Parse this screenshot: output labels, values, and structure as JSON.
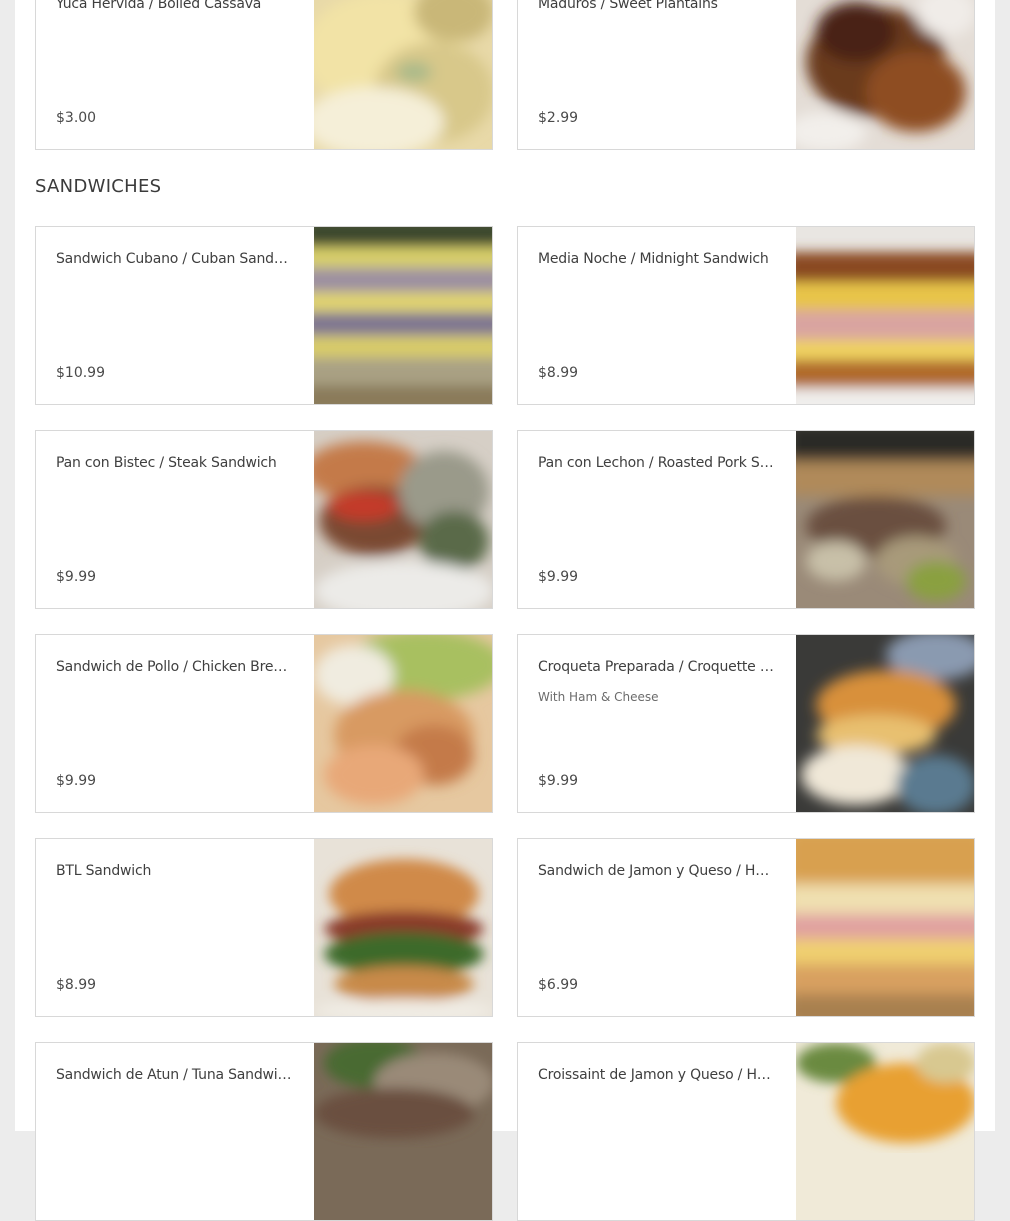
{
  "top_items": [
    {
      "name": "Yuca Hervida / Boiled Cassava",
      "price": "$3.00",
      "image": "boiled-cassava-photo"
    },
    {
      "name": "Maduros / Sweet Plantains",
      "price": "$2.99",
      "image": "sweet-plantains-photo"
    }
  ],
  "section": {
    "title": "SANDWICHES"
  },
  "items": [
    {
      "name": "Sandwich Cubano / Cuban Sandwich",
      "price": "$10.99",
      "image": "cuban-sandwich-photo"
    },
    {
      "name": "Media Noche / Midnight Sandwich",
      "price": "$8.99",
      "image": "midnight-sandwich-photo"
    },
    {
      "name": "Pan con Bistec / Steak Sandwich",
      "price": "$9.99",
      "image": "steak-sandwich-photo"
    },
    {
      "name": "Pan con Lechon / Roasted Pork Sandwich",
      "price": "$9.99",
      "image": "roasted-pork-sandwich-photo"
    },
    {
      "name": "Sandwich de Pollo / Chicken Breast Sandwich",
      "price": "$9.99",
      "image": "chicken-sandwich-photo"
    },
    {
      "name": "Croqueta Preparada / Croquette Sandwich",
      "description": "With Ham & Cheese",
      "price": "$9.99",
      "image": "croquette-sandwich-photo"
    },
    {
      "name": "BTL Sandwich",
      "price": "$8.99",
      "image": "btl-sandwich-photo"
    },
    {
      "name": "Sandwich de Jamon y Queso / Ham & Cheese Sandwich",
      "price": "$6.99",
      "image": "ham-cheese-sandwich-photo"
    },
    {
      "name": "Sandwich de Atun / Tuna Sandwich",
      "price": "",
      "image": "tuna-sandwich-photo"
    },
    {
      "name": "Croissaint de Jamon y Queso / Ham & Cheese Croissant",
      "price": "",
      "image": "ham-cheese-croissant-photo"
    }
  ]
}
